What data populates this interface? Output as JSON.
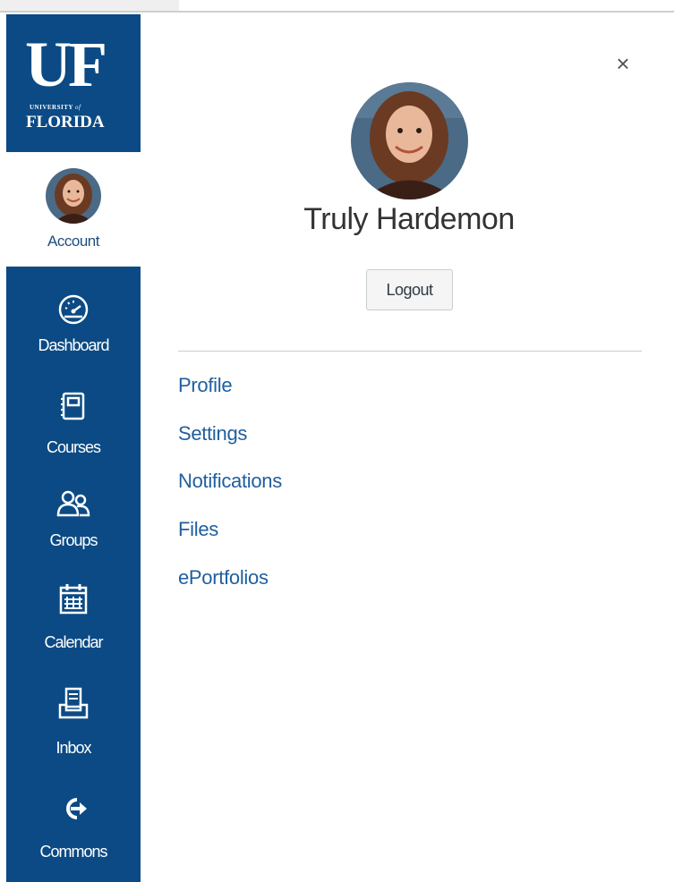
{
  "logo": {
    "main": "UF",
    "univ": "UNIVERSITY",
    "of": "of",
    "state": "FLORIDA"
  },
  "sidebar": {
    "account_label": "Account",
    "items": [
      {
        "label": "Dashboard",
        "icon": "dashboard-icon"
      },
      {
        "label": "Courses",
        "icon": "courses-icon"
      },
      {
        "label": "Groups",
        "icon": "groups-icon"
      },
      {
        "label": "Calendar",
        "icon": "calendar-icon"
      },
      {
        "label": "Inbox",
        "icon": "inbox-icon"
      },
      {
        "label": "Commons",
        "icon": "commons-icon"
      }
    ]
  },
  "panel": {
    "close_label": "×",
    "user_name": "Truly Hardemon",
    "logout_label": "Logout",
    "links": [
      "Profile",
      "Settings",
      "Notifications",
      "Files",
      "ePortfolios"
    ]
  },
  "colors": {
    "sidebar_bg": "#0b4a84",
    "link": "#1f5f9e",
    "account_label": "#1e4e7d"
  }
}
